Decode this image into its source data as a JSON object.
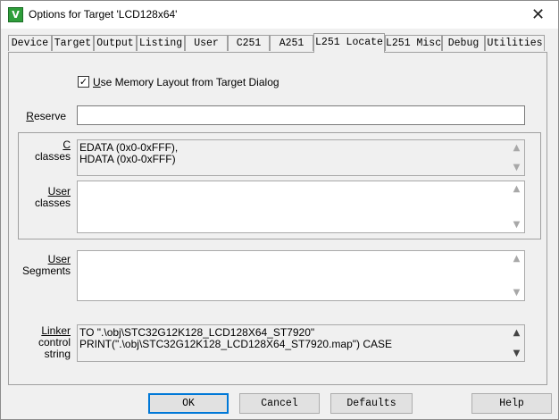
{
  "window": {
    "title": "Options for Target 'LCD128x64'",
    "app_icon_glyph": "V",
    "close_glyph": "✕"
  },
  "tabs": [
    {
      "label": "Device"
    },
    {
      "label": "Target"
    },
    {
      "label": "Output"
    },
    {
      "label": "Listing"
    },
    {
      "label": "User"
    },
    {
      "label": "C251"
    },
    {
      "label": "A251"
    },
    {
      "label": "L251 Locate"
    },
    {
      "label": "L251 Misc"
    },
    {
      "label": "Debug"
    },
    {
      "label": "Utilities"
    }
  ],
  "active_tab": "L251 Locate",
  "use_memory_layout": {
    "checked": true,
    "check_glyph": "✓",
    "label": "Use Memory Layout from Target Dialog",
    "label_ul": "U",
    "label_rest": "se Memory Layout from Target Dialog"
  },
  "reserve": {
    "label_ul": "R",
    "label_rest": "eserve",
    "value": ""
  },
  "c_classes": {
    "label_line1": "C",
    "label_line2": "classes",
    "lines": [
      "EDATA (0x0-0xFFF),",
      "HDATA (0x0-0xFFF)"
    ]
  },
  "user_classes": {
    "label_line1": "User",
    "label_line2": "classes",
    "value": ""
  },
  "user_segments": {
    "label_line1": "User",
    "label_line2": "Segments",
    "value": ""
  },
  "linker_control": {
    "label_line1": "Linker",
    "label_line2": "control",
    "label_line3": "string",
    "lines": [
      "TO \".\\obj\\STC32G12K128_LCD128X64_ST7920\"",
      "PRINT(\".\\obj\\STC32G12K128_LCD128X64_ST7920.map\") CASE"
    ]
  },
  "scroll_arrows": {
    "up": "▲",
    "down": "▼"
  },
  "buttons": {
    "ok": "OK",
    "cancel": "Cancel",
    "defaults": "Defaults",
    "help": "Help"
  }
}
